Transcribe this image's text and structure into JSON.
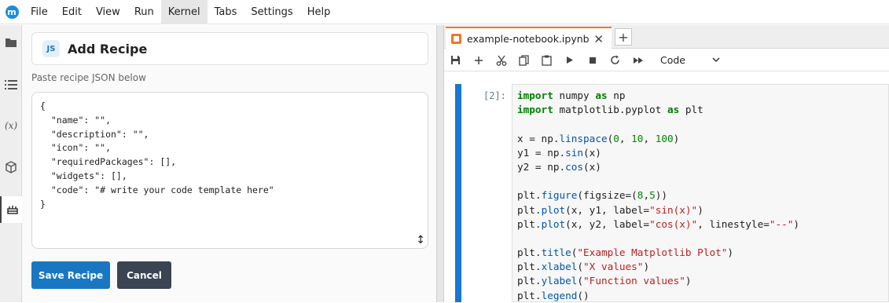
{
  "menu": [
    "File",
    "Edit",
    "View",
    "Run",
    "Kernel",
    "Tabs",
    "Settings",
    "Help"
  ],
  "logo_letter": "m",
  "panel": {
    "badge": "JS",
    "title": "Add Recipe",
    "hint": "Paste recipe JSON below",
    "editor_text": "{\n  \"name\": \"\",\n  \"description\": \"\",\n  \"icon\": \"\",\n  \"requiredPackages\": [],\n  \"widgets\": [],\n  \"code\": \"# write your code template here\"\n}",
    "save_label": "Save Recipe",
    "cancel_label": "Cancel"
  },
  "notebook": {
    "tab_label": "example-notebook.ipynb",
    "close_glyph": "✕",
    "add_glyph": "+",
    "cell_type": "Code",
    "prompt": "[2]:",
    "code": {
      "l1": [
        "import",
        " numpy ",
        "as",
        " np"
      ],
      "l2": [
        "import",
        " matplotlib.pyplot ",
        "as",
        " plt"
      ],
      "l4": [
        "x = np.",
        "linspace",
        "(",
        "0",
        ", ",
        "10",
        ", ",
        "100",
        ")"
      ],
      "l5": [
        "y1 = np.",
        "sin",
        "(x)"
      ],
      "l6": [
        "y2 = np.",
        "cos",
        "(x)"
      ],
      "l8": [
        "plt.",
        "figure",
        "(figsize=(",
        "8",
        ",",
        "5",
        "))"
      ],
      "l9": [
        "plt.",
        "plot",
        "(x, y1, label=",
        "\"sin(x)\"",
        ")"
      ],
      "l10": [
        "plt.",
        "plot",
        "(x, y2, label=",
        "\"cos(x)\"",
        ", linestyle=",
        "\"--\"",
        ")"
      ],
      "l12": [
        "plt.",
        "title",
        "(",
        "\"Example Matplotlib Plot\"",
        ")"
      ],
      "l13": [
        "plt.",
        "xlabel",
        "(",
        "\"X values\"",
        ")"
      ],
      "l14": [
        "plt.",
        "ylabel",
        "(",
        "\"Function values\"",
        ")"
      ],
      "l15": [
        "plt.",
        "legend",
        "()"
      ]
    }
  }
}
